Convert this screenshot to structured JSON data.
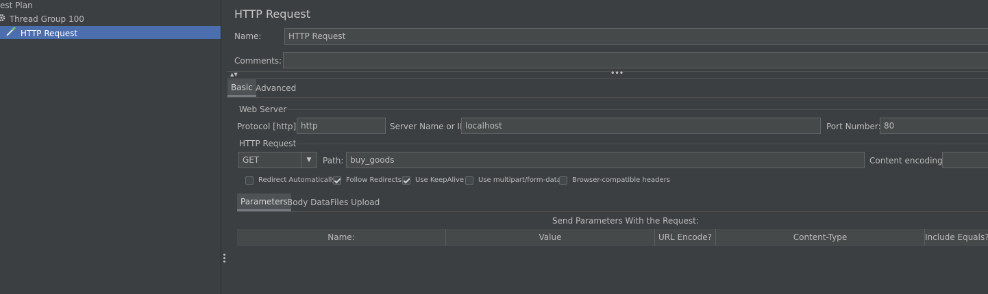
{
  "tree": {
    "items": [
      {
        "label": "est Plan"
      },
      {
        "label": "Thread Group 100"
      },
      {
        "label": "HTTP Request"
      }
    ]
  },
  "panel": {
    "title": "HTTP Request",
    "name_label": "Name:",
    "name_value": "HTTP Request",
    "comments_label": "Comments:",
    "comments_value": ""
  },
  "tabs": {
    "basic": "Basic",
    "advanced": "Advanced"
  },
  "web_server": {
    "title": "Web Server",
    "protocol_label": "Protocol [http]:",
    "protocol_value": "http",
    "server_label": "Server Name or IP:",
    "server_value": "localhost",
    "port_label": "Port Number:",
    "port_value": "80"
  },
  "http_request": {
    "title": "HTTP Request",
    "method": "GET",
    "path_label": "Path:",
    "path_value": "buy_goods",
    "encoding_label": "Content encoding:",
    "encoding_value": ""
  },
  "options": [
    {
      "label": "Redirect Automatically",
      "checked": false
    },
    {
      "label": "Follow Redirects",
      "checked": true
    },
    {
      "label": "Use KeepAlive",
      "checked": true
    },
    {
      "label": "Use multipart/form-data",
      "checked": false
    },
    {
      "label": "Browser-compatible headers",
      "checked": false
    }
  ],
  "param_tabs": {
    "parameters": "Parameters",
    "body_data": "Body Data",
    "files_upload": "Files Upload"
  },
  "params_table": {
    "caption": "Send Parameters With the Request:",
    "columns": [
      "Name:",
      "Value",
      "URL Encode?",
      "Content-Type",
      "Include Equals?"
    ]
  },
  "colors": {
    "background": "#3c3f41",
    "selection": "#4b6eaf",
    "field": "#45494a"
  }
}
